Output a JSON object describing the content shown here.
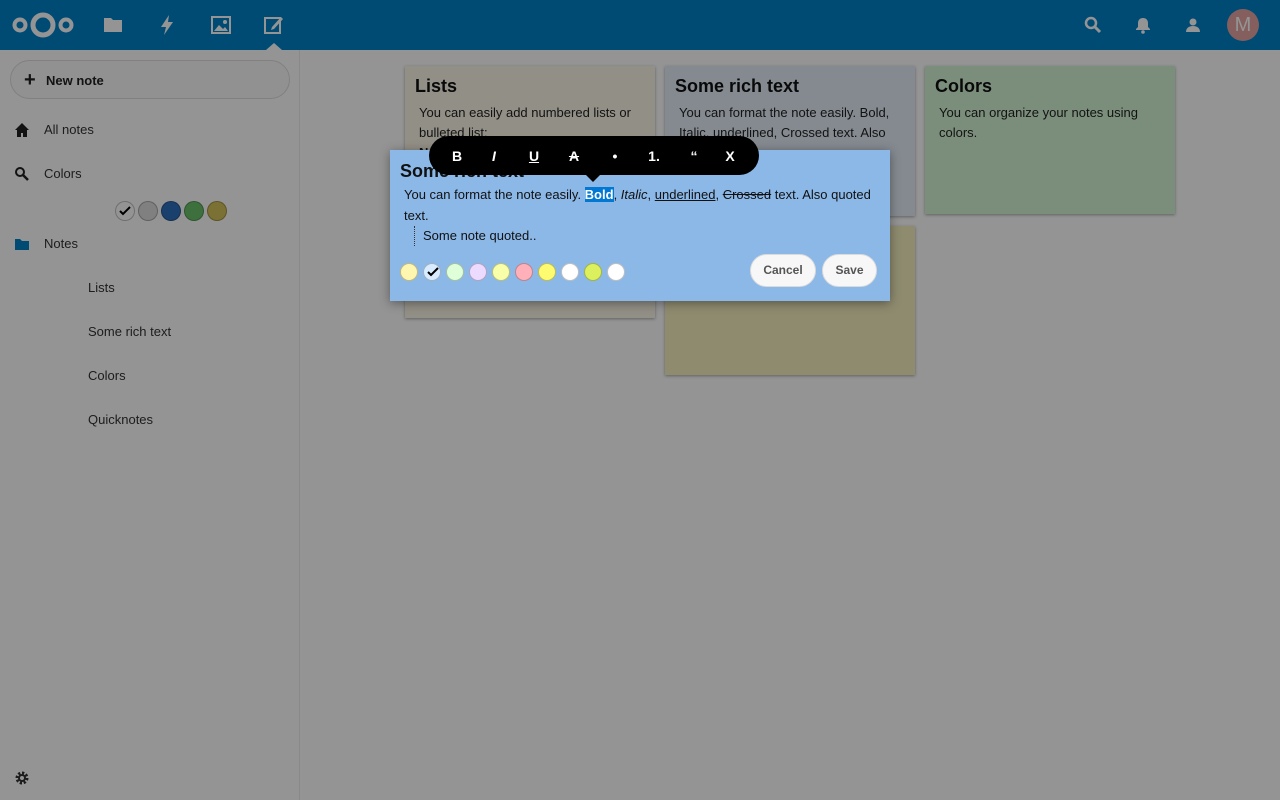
{
  "header": {
    "apps": [
      {
        "name": "files"
      },
      {
        "name": "activity"
      },
      {
        "name": "gallery"
      },
      {
        "name": "notes"
      }
    ],
    "avatar_letter": "M"
  },
  "sidebar": {
    "new_note_label": "New note",
    "all_notes_label": "All notes",
    "colors_label": "Colors",
    "color_filters": [
      "#ffffff",
      "#dcdcdc",
      "#2e6fbc",
      "#6cc16c",
      "#d4c35a"
    ],
    "notes_label": "Notes",
    "note_links": [
      "Lists",
      "Some rich text",
      "Colors",
      "Quicknotes"
    ]
  },
  "notes": [
    {
      "title": "Lists",
      "body": "You can easily add numbered lists or bulleted list:",
      "body_extra": "N",
      "color": "#fbf6e7"
    },
    {
      "title": "Some rich text",
      "body": "You can format the note easily. Bold, Italic, underlined, Crossed text. Also",
      "color": "#e3eef9"
    },
    {
      "title": "Colors",
      "body": "You can organize your notes using colors.",
      "color": "#d5f5d5"
    },
    {
      "title": "",
      "body": "",
      "color": "#f5f0c0"
    }
  ],
  "editor": {
    "title": "Some rich text",
    "text_before": "You can format the note easily. ",
    "bold": "Bold",
    "sep1": ", ",
    "italic": "Italic",
    "sep2": ", ",
    "underlined": "underlined",
    "sep3": ", ",
    "crossed": "Crossed",
    "text_after": " text. Also quoted text.",
    "quote": "Some note quoted..",
    "color": "#8cb8e8",
    "swatches": [
      "#fff7b0",
      "#d8ecff",
      "#dfffd8",
      "#ecdaff",
      "#f8ffa8",
      "#ffb0b8",
      "#fffb70",
      "#ffffff",
      "#dbf05c",
      "#ffffff"
    ],
    "selected_swatch_index": 1,
    "cancel_label": "Cancel",
    "save_label": "Save"
  },
  "toolbar": {
    "buttons": [
      "B",
      "I",
      "U",
      "A",
      "•",
      "1.",
      "“",
      "X"
    ]
  }
}
